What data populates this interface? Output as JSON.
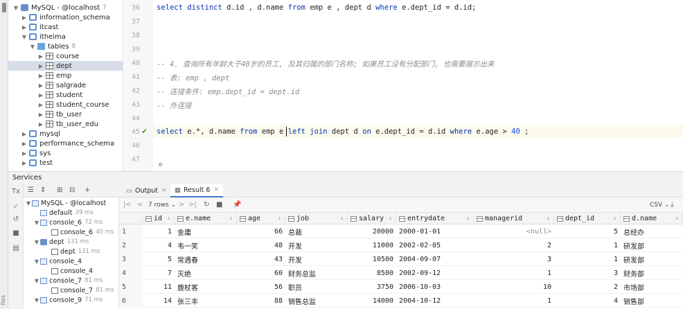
{
  "tree": {
    "root": {
      "label": "MySQL - @localhost",
      "count": "7"
    },
    "items": [
      {
        "label": "information_schema"
      },
      {
        "label": "itcast"
      },
      {
        "label": "itheima"
      },
      {
        "label": "tables",
        "count": "8"
      },
      {
        "label": "course"
      },
      {
        "label": "dept"
      },
      {
        "label": "emp"
      },
      {
        "label": "salgrade"
      },
      {
        "label": "student"
      },
      {
        "label": "student_course"
      },
      {
        "label": "tb_user"
      },
      {
        "label": "tb_user_edu"
      },
      {
        "label": "mysql"
      },
      {
        "label": "performance_schema"
      },
      {
        "label": "sys"
      },
      {
        "label": "test"
      }
    ]
  },
  "editor": {
    "line_numbers": [
      "36",
      "37",
      "38",
      "39",
      "40",
      "41",
      "42",
      "43",
      "44",
      "45",
      "46",
      "47"
    ],
    "line36": {
      "kw1": "select distinct",
      "t1": " d.id , d.name ",
      "kw2": "from",
      "t2": " emp e , dept d ",
      "kw3": "where",
      "t3": " e.dept_id = d.id;"
    },
    "comment1": "-- 4. 查询所有年龄大于40岁的员工, 及其归属的部门名称; 如果员工没有分配部门, 也需要展示出来",
    "comment2": "-- 表: emp , dept",
    "comment3": "-- 连接条件: emp.dept_id = dept.id",
    "comment4": "-- 外连接",
    "line45": {
      "kw1": "select",
      "t1": " e.*, d.name ",
      "kw2": "from",
      "t2": " emp e ",
      "kw3": "left join",
      "t3": " dept d ",
      "kw4": "on",
      "t4": " e.dept_id = d.id ",
      "kw5": "where",
      "t5": " e.age > ",
      "num": "40",
      "t6": " ;"
    },
    "breadcrumb": "e"
  },
  "services": {
    "title": "Services",
    "tree": [
      {
        "label": "MySQL - @localhost",
        "ms": ""
      },
      {
        "label": "default",
        "ms": "39 ms"
      },
      {
        "label": "console_6",
        "ms": "72 ms"
      },
      {
        "label": "console_6",
        "ms": "40 ms"
      },
      {
        "label": "dept",
        "ms": "131 ms"
      },
      {
        "label": "dept",
        "ms": "131 ms"
      },
      {
        "label": "console_4",
        "ms": ""
      },
      {
        "label": "console_4",
        "ms": ""
      },
      {
        "label": "console_7",
        "ms": "81 ms"
      },
      {
        "label": "console_7",
        "ms": "81 ms"
      },
      {
        "label": "console_9",
        "ms": "71 ms"
      }
    ]
  },
  "results": {
    "tabs": [
      "Output",
      "Result 6"
    ],
    "rows_label": "7 rows",
    "export": "CSV",
    "columns": [
      "id",
      "e.name",
      "age",
      "job",
      "salary",
      "entrydate",
      "managerid",
      "dept_id",
      "d.name"
    ],
    "rows": [
      [
        "1",
        "1",
        "金庸",
        "66",
        "总裁",
        "20000",
        "2000-01-01",
        "<null>",
        "5",
        "总经办"
      ],
      [
        "2",
        "4",
        "韦一笑",
        "48",
        "开发",
        "11000",
        "2002-02-05",
        "2",
        "1",
        "研发部"
      ],
      [
        "3",
        "5",
        "常遇春",
        "43",
        "开发",
        "10500",
        "2004-09-07",
        "3",
        "1",
        "研发部"
      ],
      [
        "4",
        "7",
        "灭绝",
        "60",
        "财务总监",
        "8500",
        "2002-09-12",
        "1",
        "3",
        "财务部"
      ],
      [
        "5",
        "11",
        "鹿杖客",
        "56",
        "职员",
        "3750",
        "2006-10-03",
        "10",
        "2",
        "市场部"
      ],
      [
        "6",
        "14",
        "张三丰",
        "88",
        "销售总监",
        "14000",
        "2004-10-12",
        "1",
        "4",
        "销售部"
      ]
    ]
  },
  "colors": {
    "keyword": "#0033b3",
    "comment": "#8c8c8c",
    "selection": "#d6dde8",
    "success": "#3b9c3b"
  }
}
